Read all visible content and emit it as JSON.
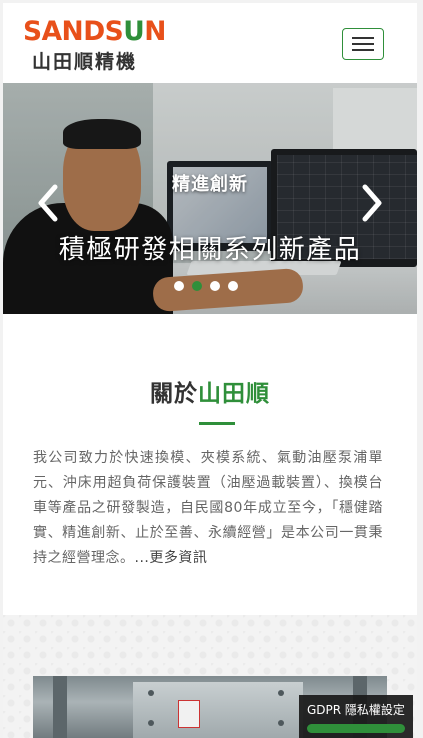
{
  "header": {
    "logo_en_part1": "SANDS",
    "logo_en_part2": "U",
    "logo_en_part3": "N",
    "logo_zh": "山田順精機",
    "menu_icon": "hamburger-icon"
  },
  "carousel": {
    "title": "精進創新",
    "subtitle": "積極研發相關系列新產品",
    "prev_icon": "chevron-left-icon",
    "next_icon": "chevron-right-icon",
    "slides": 4,
    "active_index": 1
  },
  "about": {
    "title_prefix": "關於",
    "title_accent": "山田順",
    "body": "我公司致力於快速換模、夾模系統、氣動油壓泵浦單元、沖床用超負荷保護裝置（油壓過載裝置）、換模台車等產品之研發製造，自民國80年成立至今，「穩健踏實、精進創新、止於至善、永續經營」是本公司一貫秉持之經營理念。",
    "more_link": "...更多資訊"
  },
  "gdpr": {
    "label": "GDPR 隱私權設定"
  },
  "colors": {
    "brand_green": "#2f8f3a",
    "brand_orange": "#e8501a"
  }
}
